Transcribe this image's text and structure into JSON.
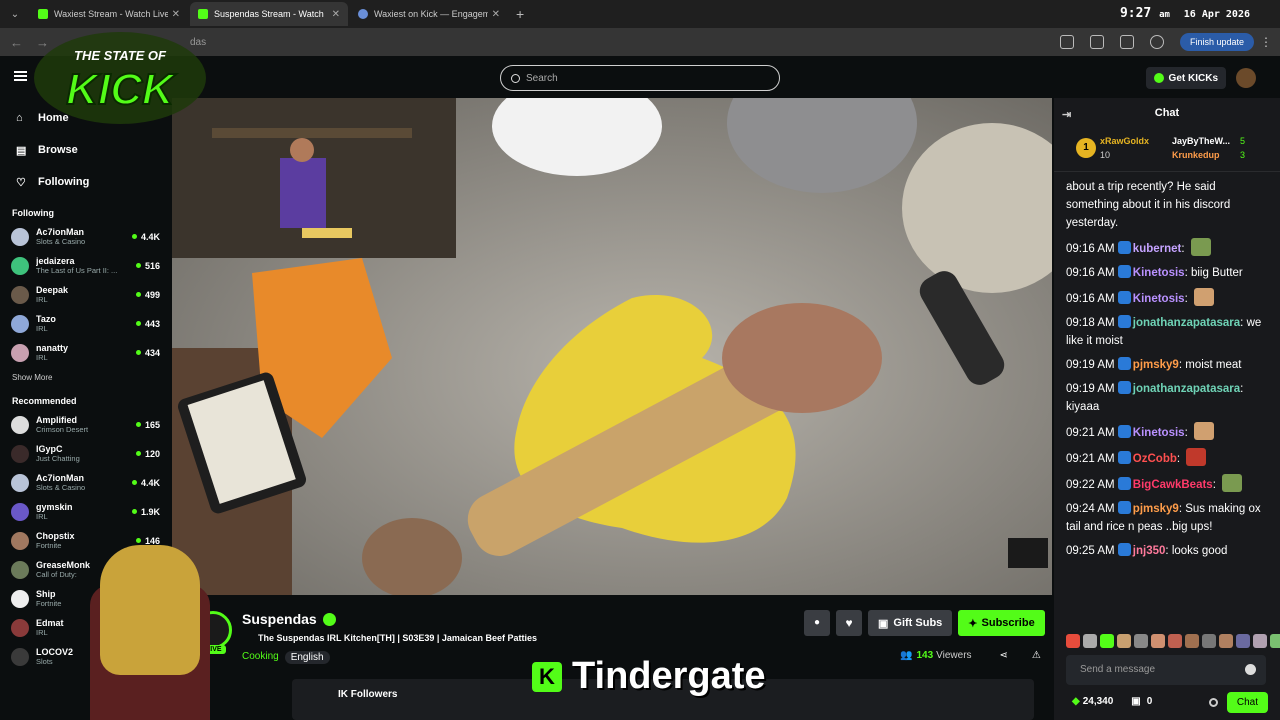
{
  "browser": {
    "tabs": [
      {
        "title": "Waxiest Stream - Watch Live on",
        "active": false
      },
      {
        "title": "Suspendas Stream - Watch",
        "active": true
      },
      {
        "title": "Waxiest on Kick — Engagemen",
        "active": false
      }
    ],
    "url": "das",
    "finish_update": "Finish update"
  },
  "overlay": {
    "clock_time": "9:27",
    "clock_ampm": "am",
    "clock_date": "16 Apr 2026",
    "logo_line1": "THE STATE OF",
    "logo_line2": "KICK",
    "banner_text": "Tindergate"
  },
  "header": {
    "search_placeholder": "Search",
    "get_kicks": "Get KICKs"
  },
  "sidebar": {
    "nav": [
      {
        "label": "Home",
        "icon": "home-icon"
      },
      {
        "label": "Browse",
        "icon": "browse-icon"
      },
      {
        "label": "Following",
        "icon": "heart-icon"
      }
    ],
    "following_title": "Following",
    "following": [
      {
        "name": "Ac7ionMan",
        "category": "Slots & Casino",
        "viewers": "4.4K",
        "color": "#b9c4d8"
      },
      {
        "name": "jedaizera",
        "category": "The Last of Us Part II: ...",
        "viewers": "516",
        "color": "#3ec27c"
      },
      {
        "name": "Deepak",
        "category": "IRL",
        "viewers": "499",
        "color": "#6a5a4a"
      },
      {
        "name": "Tazo",
        "category": "IRL",
        "viewers": "443",
        "color": "#8fa8d8"
      },
      {
        "name": "nanatty",
        "category": "IRL",
        "viewers": "434",
        "color": "#c8a0b0"
      }
    ],
    "show_more": "Show More",
    "recommended_title": "Recommended",
    "recommended": [
      {
        "name": "Amplified",
        "category": "Crimson Desert",
        "viewers": "165",
        "color": "#ddd"
      },
      {
        "name": "lGypC",
        "category": "Just Chatting",
        "viewers": "120",
        "color": "#3a2a2a"
      },
      {
        "name": "Ac7ionMan",
        "category": "Slots & Casino",
        "viewers": "4.4K",
        "color": "#b9c4d8"
      },
      {
        "name": "gymskin",
        "category": "IRL",
        "viewers": "1.9K",
        "color": "#6a58c8"
      },
      {
        "name": "Chopstix",
        "category": "Fortnite",
        "viewers": "146",
        "color": "#a07860"
      },
      {
        "name": "GreaseMonk",
        "category": "Call of Duty:",
        "viewers": "",
        "color": "#6b7a5a"
      },
      {
        "name": "Ship",
        "category": "Fortnite",
        "viewers": "",
        "color": "#eee"
      },
      {
        "name": "Edmat",
        "category": "IRL",
        "viewers": "",
        "color": "#8a3a3a"
      },
      {
        "name": "LOCOV2",
        "category": "Slots",
        "viewers": "",
        "color": "#3a3a3a"
      }
    ]
  },
  "stream": {
    "streamer": "Suspendas",
    "live_label": "LIVE",
    "title": "The Suspendas IRL Kitchen[TH] | S03E39 | Jamaican Beef Patties",
    "category": "Cooking",
    "language": "English",
    "viewers": "143",
    "viewers_label": "Viewers",
    "gift_subs": "Gift Subs",
    "subscribe": "Subscribe",
    "followers_text": "IK Followers"
  },
  "chat": {
    "header": "Chat",
    "leaderboard": [
      {
        "rank": "1",
        "name": "xRawGoldx",
        "value": "10"
      },
      {
        "name": "JayByTheW...",
        "value": "5"
      },
      {
        "name": "Krunkedup",
        "value": "3"
      }
    ],
    "messages": [
      {
        "time": "",
        "user": "",
        "text": "about a trip recently? He said something about it in his discord yesterday.",
        "color": "#fff"
      },
      {
        "time": "09:16 AM",
        "user": "kubernet",
        "text": "",
        "color": "#c5a3ff"
      },
      {
        "time": "09:16 AM",
        "user": "Kinetosis",
        "text": "biig Butter",
        "color": "#b991ff"
      },
      {
        "time": "09:16 AM",
        "user": "Kinetosis",
        "text": "",
        "color": "#b991ff"
      },
      {
        "time": "09:18 AM",
        "user": "jonathanzapatasara",
        "text": "we like it moist",
        "color": "#6fd3b6"
      },
      {
        "time": "09:19 AM",
        "user": "pjmsky9",
        "text": "moist meat",
        "color": "#ff9d4a"
      },
      {
        "time": "09:19 AM",
        "user": "jonathanzapatasara",
        "text": "kiyaaa",
        "color": "#6fd3b6"
      },
      {
        "time": "09:21 AM",
        "user": "Kinetosis",
        "text": "",
        "color": "#b991ff"
      },
      {
        "time": "09:21 AM",
        "user": "OzCobb",
        "text": "",
        "color": "#ff5050"
      },
      {
        "time": "09:22 AM",
        "user": "BigCawkBeats",
        "text": "",
        "color": "#ff3a6a"
      },
      {
        "time": "09:24 AM",
        "user": "pjmsky9",
        "text": "Sus making ox tail and rice n peas ..big ups!",
        "color": "#ff9d4a"
      },
      {
        "time": "09:25 AM",
        "user": "jnj350",
        "text": "looks good",
        "color": "#ff7a9c"
      }
    ],
    "send_placeholder": "Send a message",
    "points": "24,340",
    "count": "0",
    "chat_button": "Chat"
  }
}
